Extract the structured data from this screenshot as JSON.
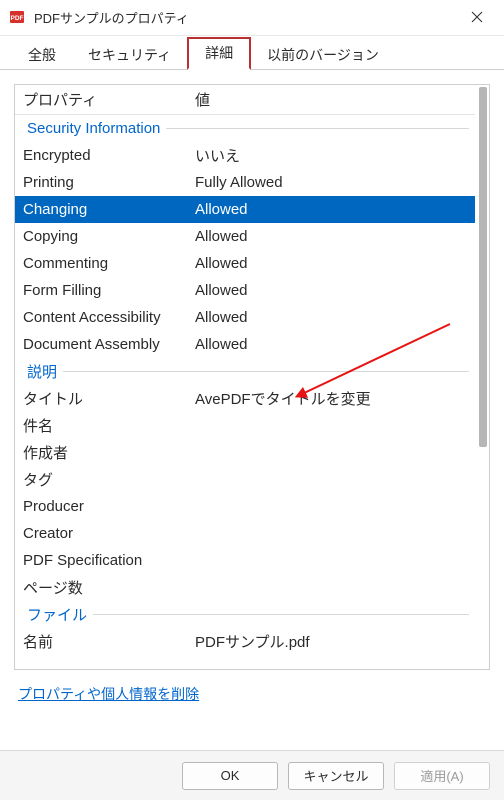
{
  "window": {
    "title": "PDFサンプルのプロパティ"
  },
  "tabs": {
    "general": "全般",
    "security": "セキュリティ",
    "details": "詳細",
    "previous": "以前のバージョン"
  },
  "headers": {
    "property": "プロパティ",
    "value": "値"
  },
  "sections": {
    "security_info": "Security Information",
    "description": "説明",
    "file": "ファイル"
  },
  "security": {
    "encrypted": {
      "label": "Encrypted",
      "value": "いいえ"
    },
    "printing": {
      "label": "Printing",
      "value": "Fully Allowed"
    },
    "changing": {
      "label": "Changing",
      "value": "Allowed"
    },
    "copying": {
      "label": "Copying",
      "value": "Allowed"
    },
    "commenting": {
      "label": "Commenting",
      "value": "Allowed"
    },
    "form_filling": {
      "label": "Form Filling",
      "value": "Allowed"
    },
    "content_accessibility": {
      "label": "Content Accessibility",
      "value": "Allowed"
    },
    "document_assembly": {
      "label": "Document Assembly",
      "value": "Allowed"
    }
  },
  "description": {
    "title": {
      "label": "タイトル",
      "value": "AvePDFでタイトルを変更"
    },
    "subject": {
      "label": "件名",
      "value": ""
    },
    "author": {
      "label": "作成者",
      "value": ""
    },
    "tags": {
      "label": "タグ",
      "value": ""
    },
    "producer": {
      "label": "Producer",
      "value": ""
    },
    "creator": {
      "label": "Creator",
      "value": ""
    },
    "pdf_spec": {
      "label": "PDF Specification",
      "value": ""
    },
    "pages": {
      "label": "ページ数",
      "value": ""
    }
  },
  "file": {
    "name": {
      "label": "名前",
      "value": "PDFサンプル.pdf"
    }
  },
  "link": {
    "remove_info": "プロパティや個人情報を削除"
  },
  "buttons": {
    "ok": "OK",
    "cancel": "キャンセル",
    "apply": "適用(A)"
  }
}
